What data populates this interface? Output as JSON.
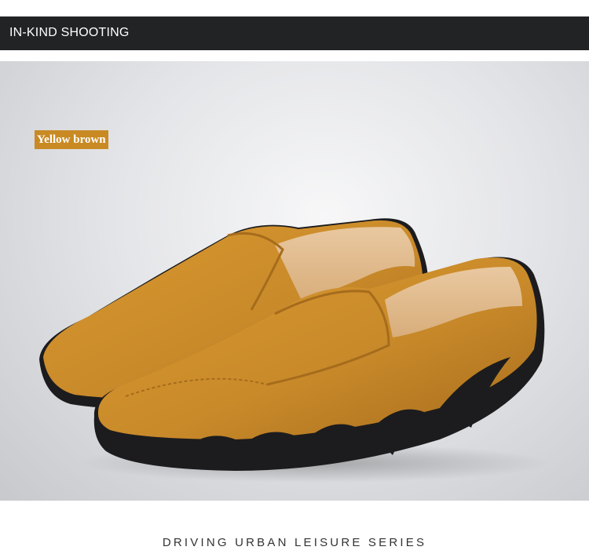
{
  "header": {
    "title": "IN-KIND SHOOTING"
  },
  "photo": {
    "color_label": "Yellow brown",
    "shoe_color": "#c98a2a",
    "sole_color": "#1c1c1e"
  },
  "footer": {
    "title": "DRIVING URBAN LEISURE SERIES"
  }
}
